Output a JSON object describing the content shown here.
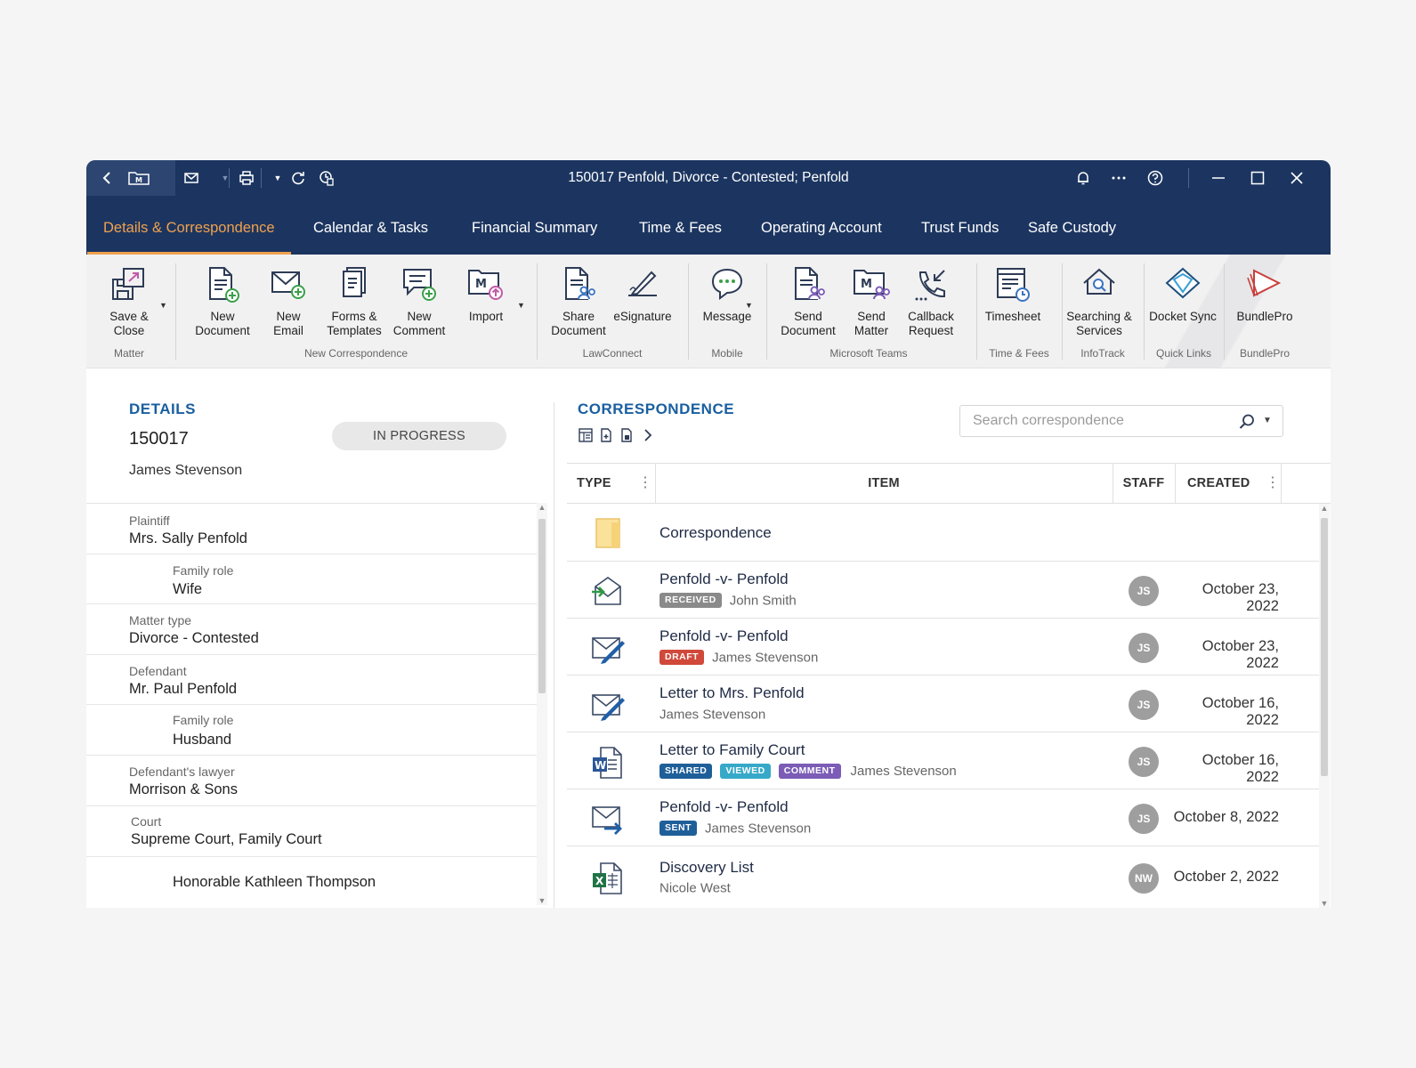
{
  "window": {
    "title": "150017 Penfold, Divorce - Contested; Penfold"
  },
  "tabs": [
    {
      "label": "Details & Correspondence",
      "active": true
    },
    {
      "label": "Calendar & Tasks"
    },
    {
      "label": "Financial Summary"
    },
    {
      "label": "Time & Fees"
    },
    {
      "label": "Operating Account"
    },
    {
      "label": "Trust Funds"
    },
    {
      "label": "Safe Custody"
    }
  ],
  "ribbon": {
    "buttons": [
      {
        "label_1": "Save &",
        "label_2": "Close",
        "icon": "save-close-icon"
      },
      {
        "label_1": "New",
        "label_2": "Document",
        "icon": "new-document-icon"
      },
      {
        "label_1": "New",
        "label_2": "Email",
        "icon": "new-email-icon"
      },
      {
        "label_1": "Forms &",
        "label_2": "Templates",
        "icon": "forms-templates-icon"
      },
      {
        "label_1": "New",
        "label_2": "Comment",
        "icon": "new-comment-icon"
      },
      {
        "label_1": "Import",
        "label_2": "",
        "icon": "import-icon"
      },
      {
        "label_1": "Share",
        "label_2": "Document",
        "icon": "share-document-icon"
      },
      {
        "label_1": "eSignature",
        "label_2": "",
        "icon": "esignature-icon"
      },
      {
        "label_1": "Message",
        "label_2": "",
        "icon": "message-icon"
      },
      {
        "label_1": "Send",
        "label_2": "Document",
        "icon": "send-document-icon"
      },
      {
        "label_1": "Send",
        "label_2": "Matter",
        "icon": "send-matter-icon"
      },
      {
        "label_1": "Callback",
        "label_2": "Request",
        "icon": "callback-request-icon"
      },
      {
        "label_1": "Timesheet",
        "label_2": "",
        "icon": "timesheet-icon"
      },
      {
        "label_1": "Searching &",
        "label_2": "Services",
        "icon": "searching-services-icon"
      },
      {
        "label_1": "Docket Sync",
        "label_2": "",
        "icon": "docket-sync-icon"
      },
      {
        "label_1": "BundlePro",
        "label_2": "",
        "icon": "bundlepro-icon"
      }
    ],
    "groups": [
      "Matter",
      "New Correspondence",
      "LawConnect",
      "Mobile",
      "Microsoft Teams",
      "Time & Fees",
      "InfoTrack",
      "Quick Links",
      "BundlePro"
    ]
  },
  "details": {
    "heading": "DETAILS",
    "matter_number": "150017",
    "client": "James Stevenson",
    "status": "IN PROGRESS",
    "fields": [
      {
        "label": "Plaintiff",
        "value": "Mrs. Sally Penfold"
      },
      {
        "label": "Family role",
        "value": "Wife"
      },
      {
        "label": "Matter type",
        "value": "Divorce - Contested"
      },
      {
        "label": "Defendant",
        "value": "Mr. Paul Penfold"
      },
      {
        "label": "Family role",
        "value": "Husband"
      },
      {
        "label": "Defendant's lawyer",
        "value": "Morrison & Sons"
      },
      {
        "label": "Court",
        "value": "Supreme Court, Family Court"
      },
      {
        "label": "",
        "value": "Honorable Kathleen Thompson"
      }
    ]
  },
  "correspondence": {
    "heading": "CORRESPONDENCE",
    "search_placeholder": "Search correspondence",
    "columns": {
      "type": "TYPE",
      "item": "ITEM",
      "staff": "STAFF",
      "created": "CREATED"
    },
    "rows": [
      {
        "title": "Correspondence",
        "icon": "folder-icon",
        "tags": [],
        "by": "",
        "staff": "",
        "date": ""
      },
      {
        "title": "Penfold -v- Penfold",
        "icon": "received-email-icon",
        "tags": [
          {
            "text": "RECEIVED",
            "color": "#8a8a8a"
          }
        ],
        "by": "John Smith",
        "staff": "JS",
        "date": "October 23, 2022"
      },
      {
        "title": "Penfold -v- Penfold",
        "icon": "draft-email-icon",
        "tags": [
          {
            "text": "DRAFT",
            "color": "#d0493a"
          }
        ],
        "by": "James Stevenson",
        "staff": "JS",
        "date": "October 23, 2022"
      },
      {
        "title": "Letter to Mrs. Penfold",
        "icon": "draft-email-icon",
        "tags": [],
        "by": "James Stevenson",
        "staff": "JS",
        "date": "October 16, 2022"
      },
      {
        "title": "Letter to Family Court",
        "icon": "word-document-icon",
        "tags": [
          {
            "text": "SHARED",
            "color": "#1f5f99"
          },
          {
            "text": "VIEWED",
            "color": "#36a9c9"
          },
          {
            "text": "COMMENT",
            "color": "#7b5cb6"
          }
        ],
        "by": "James Stevenson",
        "staff": "JS",
        "date": "October 16, 2022"
      },
      {
        "title": "Penfold -v- Penfold",
        "icon": "sent-email-icon",
        "tags": [
          {
            "text": "SENT",
            "color": "#1f5f99"
          }
        ],
        "by": "James Stevenson",
        "staff": "JS",
        "date": "October 8, 2022"
      },
      {
        "title": "Discovery List",
        "icon": "excel-document-icon",
        "tags": [],
        "by": "Nicole West",
        "staff": "NW",
        "date": "October 2, 2022"
      }
    ]
  },
  "colors": {
    "navy": "#1c3560",
    "accent": "#f0a14e",
    "heading_blue": "#1a5fa0"
  }
}
